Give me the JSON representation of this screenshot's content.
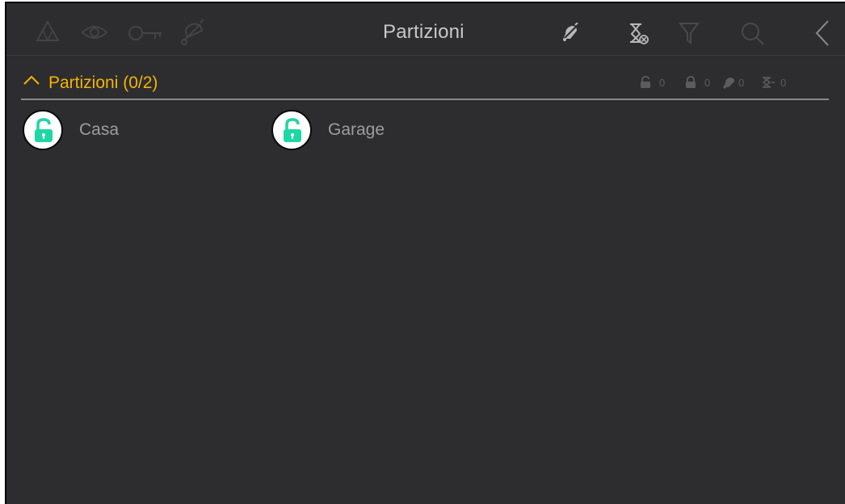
{
  "header": {
    "title": "Partizioni",
    "left_icons": [
      "alarm-warning-icon",
      "eye-icon",
      "key-icon",
      "bell-icon"
    ],
    "right_icons": [
      "bell-silence-icon",
      "hourglass-cancel-icon",
      "filter-icon",
      "search-icon",
      "back-chevron-icon"
    ]
  },
  "section": {
    "title": "Partizioni (0/2)",
    "expanded": true,
    "counters": [
      {
        "icon": "unlocked-icon",
        "value": "0"
      },
      {
        "icon": "locked-icon",
        "value": "0"
      },
      {
        "icon": "bell-icon",
        "value": "0"
      },
      {
        "icon": "hourglass-icon",
        "value": "0"
      }
    ]
  },
  "partitions": [
    {
      "name": "Casa",
      "state_icon": "unlocked-padlock-icon"
    },
    {
      "name": "Garage",
      "state_icon": "unlocked-padlock-icon"
    }
  ],
  "colors": {
    "background": "#2d2d30",
    "accent": "#f5b400",
    "unlocked": "#1ed7a3",
    "icon_dim": "#4a4a4d",
    "icon_light": "#8a8a8c",
    "text": "#9d9d9f"
  }
}
